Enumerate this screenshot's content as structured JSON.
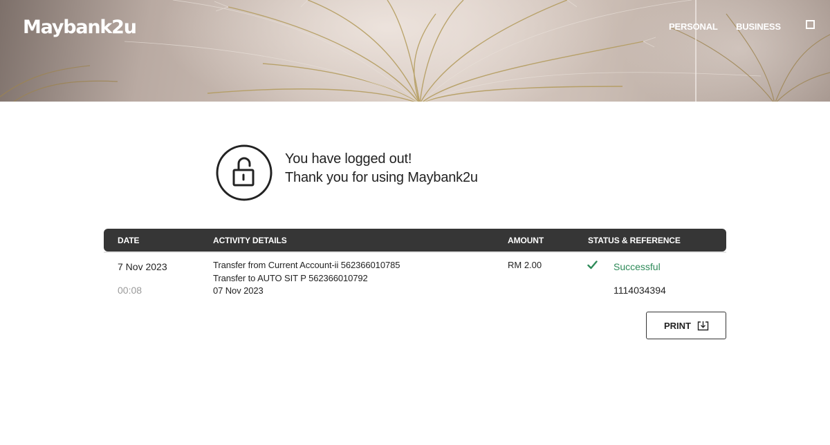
{
  "header": {
    "logo_text": "Maybank2u",
    "nav": {
      "personal": "PERSONAL",
      "business": "BUSINESS"
    },
    "menu_icon": "menu-square-icon"
  },
  "message": {
    "icon": "unlocked-padlock-icon",
    "line1": "You have logged out!",
    "line2": "Thank you for using Maybank2u"
  },
  "table": {
    "columns": [
      "DATE",
      "ACTIVITY DETAILS",
      "AMOUNT",
      "STATUS & REFERENCE"
    ],
    "rows": [
      {
        "date": "7 Nov 2023",
        "time": "00:08",
        "activity": [
          "Transfer from Current Account-ii 562366010785",
          "Transfer to AUTO SIT P 562366010792",
          "07 Nov 2023"
        ],
        "amount": "RM 2.00",
        "status": "Successful",
        "status_icon": "checkmark-icon",
        "reference": "1114034394"
      }
    ]
  },
  "print": {
    "label": "PRINT",
    "icon": "download-tray-icon"
  },
  "colors": {
    "header_bg": "#363636",
    "success": "#2d8a58",
    "text": "#222222",
    "muted": "#9a9a9a"
  }
}
